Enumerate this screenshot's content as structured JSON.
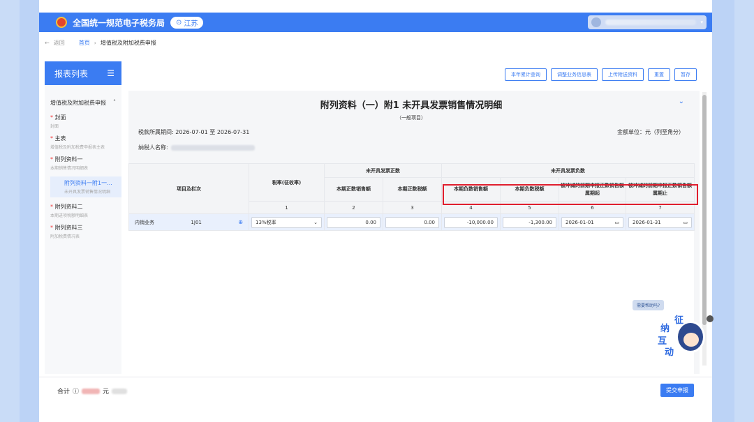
{
  "topbar": {
    "site_title": "全国统一规范电子税务局",
    "region": "江苏"
  },
  "breadcrumb": {
    "back": "返回",
    "home": "首页",
    "separator": "›",
    "current": "增值税及附加税费申报"
  },
  "sidebar": {
    "title": "报表列表",
    "group": "增值税及附加税费申报",
    "items": [
      {
        "title": "封面",
        "subtitle": "封面"
      },
      {
        "title": "主表",
        "subtitle": "增值税及附加税费申报表主表"
      },
      {
        "title": "附列资料一",
        "subtitle": "本期销售情况明细表"
      },
      {
        "title": "附列资料二",
        "subtitle": "本期进项税额明细表"
      },
      {
        "title": "附列资料三",
        "subtitle": "附加税费情况表"
      }
    ],
    "active_sub": {
      "title": "附列资料一附1一...",
      "subtitle": "未开具发票销售情况明细"
    }
  },
  "toolbar": {
    "btn1": "本年累计查询",
    "btn2": "调整业务信息表",
    "btn3": "上传附送资料",
    "btn4": "重置",
    "btn5": "暂存"
  },
  "form": {
    "title": "附列资料（一）附1 未开具发票销售情况明细",
    "subtitle": "（一般项目）",
    "period_label": "税款所属期间: 2026-07-01 至 2026-07-31",
    "unit_label": "金额单位：元（列至角分）",
    "taxpayer_label": "纳税人名称:"
  },
  "table": {
    "headers": {
      "item": "项目及栏次",
      "rate": "税率(征收率)",
      "group_positive": "未开具发票正数",
      "group_negative": "未开具发票负数",
      "c2": "本期正数销售额",
      "c3": "本期正数税额",
      "c4": "本期负数销售额",
      "c5": "本期负数税额",
      "c6": "被冲减的前期申报正数销售额属期起",
      "c7": "被冲减的前期申报正数销售额属期止"
    },
    "col_numbers": [
      "1",
      "2",
      "3",
      "4",
      "5",
      "6",
      "7"
    ],
    "row": {
      "name": "内销业务",
      "code": "1J01",
      "rate": "13%税率",
      "v2": "0.00",
      "v3": "0.00",
      "v4": "-10,000.00",
      "v5": "-1,300.00",
      "v6": "2026-01-01",
      "v7": "2026-01-31"
    }
  },
  "footer": {
    "total_label": "合计",
    "yuan": "元",
    "submit": "提交申报"
  },
  "helper": {
    "bubble": "需要帮助吗?",
    "chars": [
      "征",
      "纳",
      "互",
      "动"
    ]
  },
  "colors": {
    "brand": "#3b7cf2",
    "highlight": "#e01e2e",
    "row_bg": "#e9f0fd"
  }
}
